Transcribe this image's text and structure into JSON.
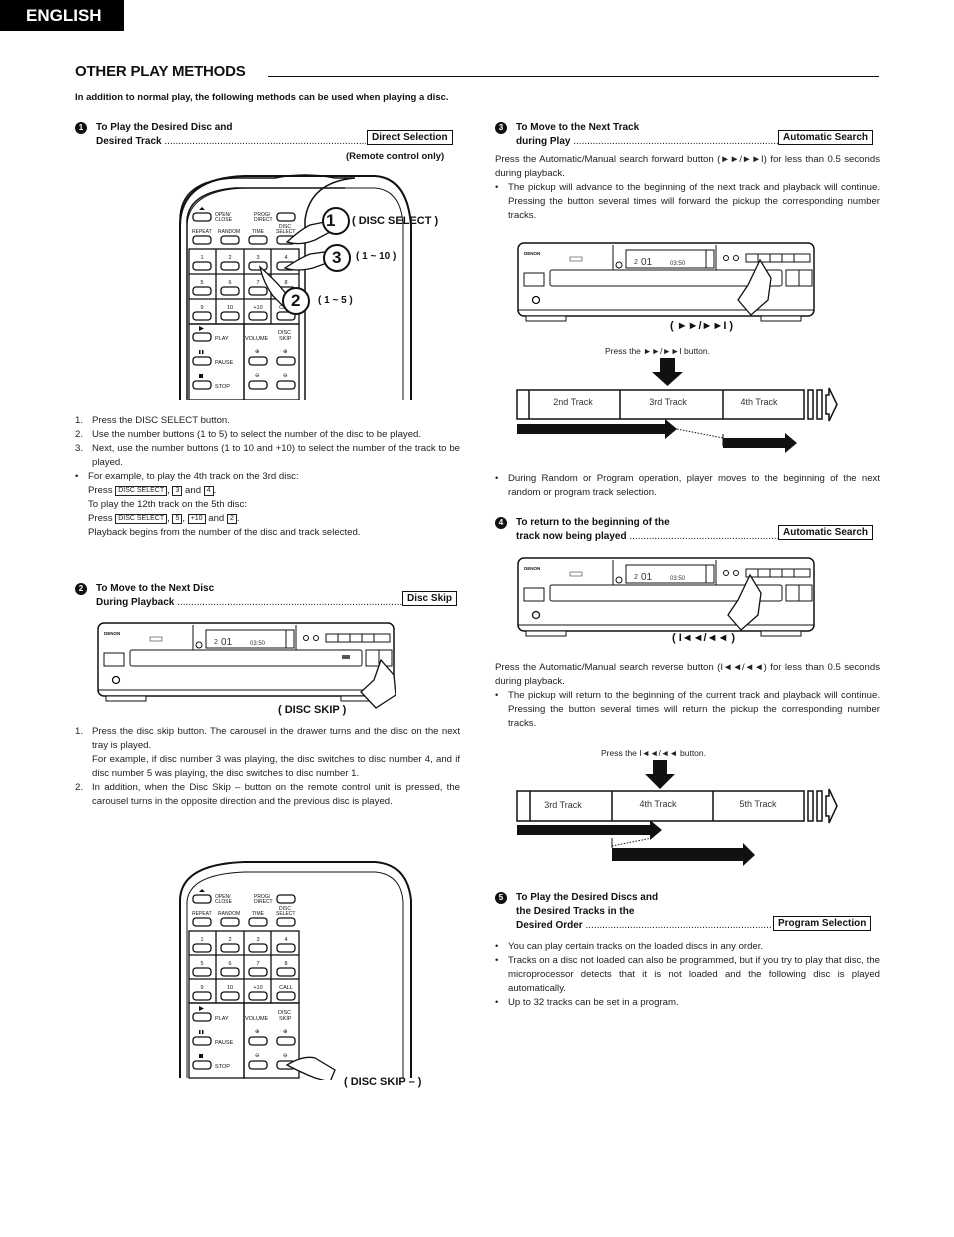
{
  "header": {
    "language_tab": "ENGLISH"
  },
  "page": {
    "title": "OTHER PLAY METHODS",
    "intro": "In addition to normal play, the following methods can be used when playing a disc."
  },
  "sections": {
    "s1": {
      "number": "1",
      "heading_line1": "To Play the Desired Disc and",
      "heading_line2": "Desired Track",
      "tag": "Direct Selection",
      "note": "(Remote control only)",
      "callouts": {
        "c1_num": "1",
        "c1_label": "( DISC SELECT )",
        "c3_num": "3",
        "c3_label": "( 1 ~ 10 )",
        "c2_num": "2",
        "c2_label": "( 1 ~ 5 )"
      },
      "steps": [
        "Press the DISC SELECT button.",
        "Use the number buttons (1 to 5) to select the number of the disc to be played.",
        "Next, use the number buttons (1 to 10 and +10) to select the number of the track to be played."
      ],
      "example": {
        "intro": "For example, to play the 4th track on the 3rd disc:",
        "press": "Press",
        "key_disc_select": "DISC SELECT",
        "key_3": "3",
        "and": "and",
        "key_4": "4",
        "intro2": "To play the 12th track on the 5th disc:",
        "key_5": "5",
        "key_plus10": "+10",
        "key_2": "2",
        "outro": "Playback begins from the number of the disc and track selected."
      }
    },
    "s2": {
      "number": "2",
      "heading_line1": "To Move to the Next Disc",
      "heading_line2": "During Playback",
      "tag": "Disc Skip",
      "callout": "( DISC SKIP )",
      "steps": [
        "Press the disc skip button. The carousel in the drawer turns and the disc on the next tray is played.",
        "For example, if disc number 3 was playing, the disc switches to disc number 4, and if disc number 5 was playing, the disc switches to disc number 1.",
        "In addition, when the Disc Skip – button on the remote control unit is pressed, the carousel turns in the opposite direction and the previous disc is played."
      ],
      "remote_callout": "( DISC SKIP – )"
    },
    "s3": {
      "number": "3",
      "heading_line1": "To Move to the Next Track",
      "heading_line2": "during Play",
      "tag": "Automatic Search",
      "para": "Press the Automatic/Manual search forward button (►►/►►I) for less than 0.5 seconds during playback.",
      "bullet": "The pickup will advance to the beginning of the next track and playback will continue. Pressing the button several times will forward the pickup the corresponding number tracks.",
      "callout": "( ►►/►►I )",
      "diagram_caption": "Press the ►►/►►I button.",
      "tracks": [
        "2nd Track",
        "3rd Track",
        "4th Track"
      ],
      "bullet2": "During Random or Program operation, player moves to the beginning of the next random or program track selection."
    },
    "s4": {
      "number": "4",
      "heading_line1": "To return to the beginning of the",
      "heading_line2": "track now being played",
      "tag": "Automatic Search",
      "callout": "( I◄◄/◄◄ )",
      "para": "Press the Automatic/Manual search reverse button (I◄◄/◄◄) for less than 0.5 seconds during playback.",
      "bullet": "The pickup will return to the beginning of the current track and playback will continue. Pressing the button several times will return the pickup the corresponding number tracks.",
      "diagram_caption": "Press the I◄◄/◄◄ button.",
      "tracks": [
        "3rd Track",
        "4th Track",
        "5th Track"
      ]
    },
    "s5": {
      "number": "5",
      "heading_line1": "To Play the Desired Discs and",
      "heading_line2": "the Desired Tracks in the",
      "heading_line3": "Desired Order",
      "tag": "Program Selection",
      "bullets": [
        "You can play certain tracks on the loaded discs in any order.",
        "Tracks on a disc not loaded can also be programmed, but if you try to play that disc, the microprocessor detects that it is not loaded and the following disc is played automatically.",
        "Up to 32 tracks can be set in a program."
      ]
    }
  },
  "remote": {
    "buttons": {
      "open_close": "OPEN/ CLOSE",
      "prog_direct": "PROG/ DIRECT",
      "repeat": "REPEAT",
      "random": "RANDOM",
      "time": "TIME",
      "disc_select": "DISC SELECT",
      "n1": "1",
      "n2": "2",
      "n3": "3",
      "n4": "4",
      "n5": "5",
      "n6": "6",
      "n7": "7",
      "n8": "8",
      "n9": "9",
      "n10": "10",
      "plus10": "+10",
      "call": "CALL",
      "play": "PLAY",
      "pause": "PAUSE",
      "stop": "STOP",
      "volume": "VOLUME",
      "disc_skip": "DISC SKIP"
    }
  },
  "player": {
    "brand": "DENON",
    "display_disc": "2",
    "display_track": "01",
    "display_time": "03:50"
  }
}
